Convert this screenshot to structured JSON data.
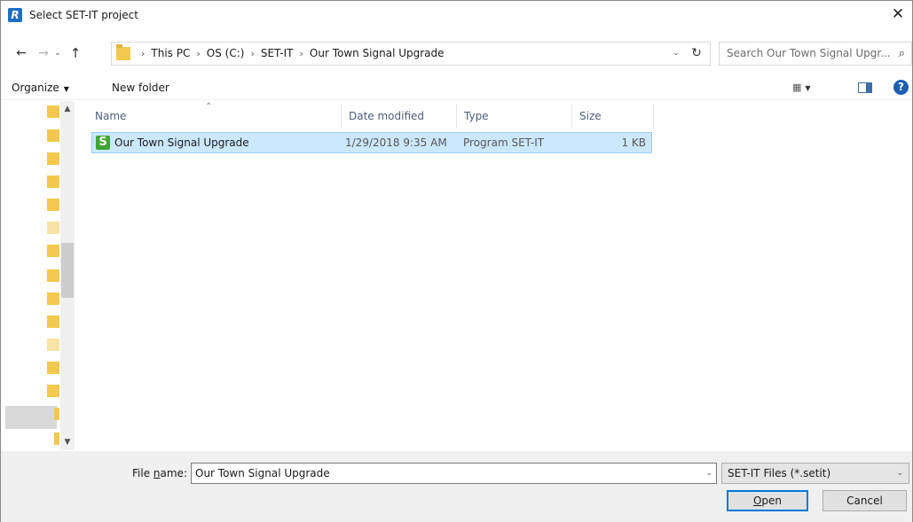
{
  "window": {
    "title": "Select SET-IT project",
    "app_icon_letter": "R",
    "close_glyph": "✕"
  },
  "nav": {
    "back_glyph": "←",
    "forward_glyph": "→",
    "recent_glyph": "⌄",
    "up_glyph": "↑"
  },
  "address": {
    "crumbs": [
      "This PC",
      "OS (C:)",
      "SET-IT",
      "Our Town Signal Upgrade"
    ],
    "separator": "›",
    "refresh_glyph": "↻",
    "dropdown_glyph": "⌄"
  },
  "search": {
    "placeholder": "Search Our Town Signal Upgr...",
    "icon": "search-icon"
  },
  "toolbar": {
    "organize_label": "Organize",
    "new_folder_label": "New folder",
    "view_glyph": "▦",
    "help_glyph": "?"
  },
  "columns": {
    "name": "Name",
    "date_modified": "Date modified",
    "type": "Type",
    "size": "Size"
  },
  "files": [
    {
      "name": "Our Town Signal Upgrade",
      "date_modified": "1/29/2018 9:35 AM",
      "type": "Program SET-IT",
      "size": "1 KB",
      "icon_letter": "S"
    }
  ],
  "bottom": {
    "file_name_prefix": "File ",
    "file_name_accel": "n",
    "file_name_suffix": "ame:",
    "file_name_value": "Our Town Signal Upgrade",
    "file_type_value": "SET-IT Files (*.setit)",
    "open_accel": "O",
    "open_rest": "pen",
    "cancel_label": "Cancel"
  },
  "colors": {
    "selection_bg": "#cce8ff",
    "selection_border": "#99d1ff",
    "accent": "#0078d7",
    "folder": "#f2c94c",
    "setit_green": "#3fa535"
  }
}
